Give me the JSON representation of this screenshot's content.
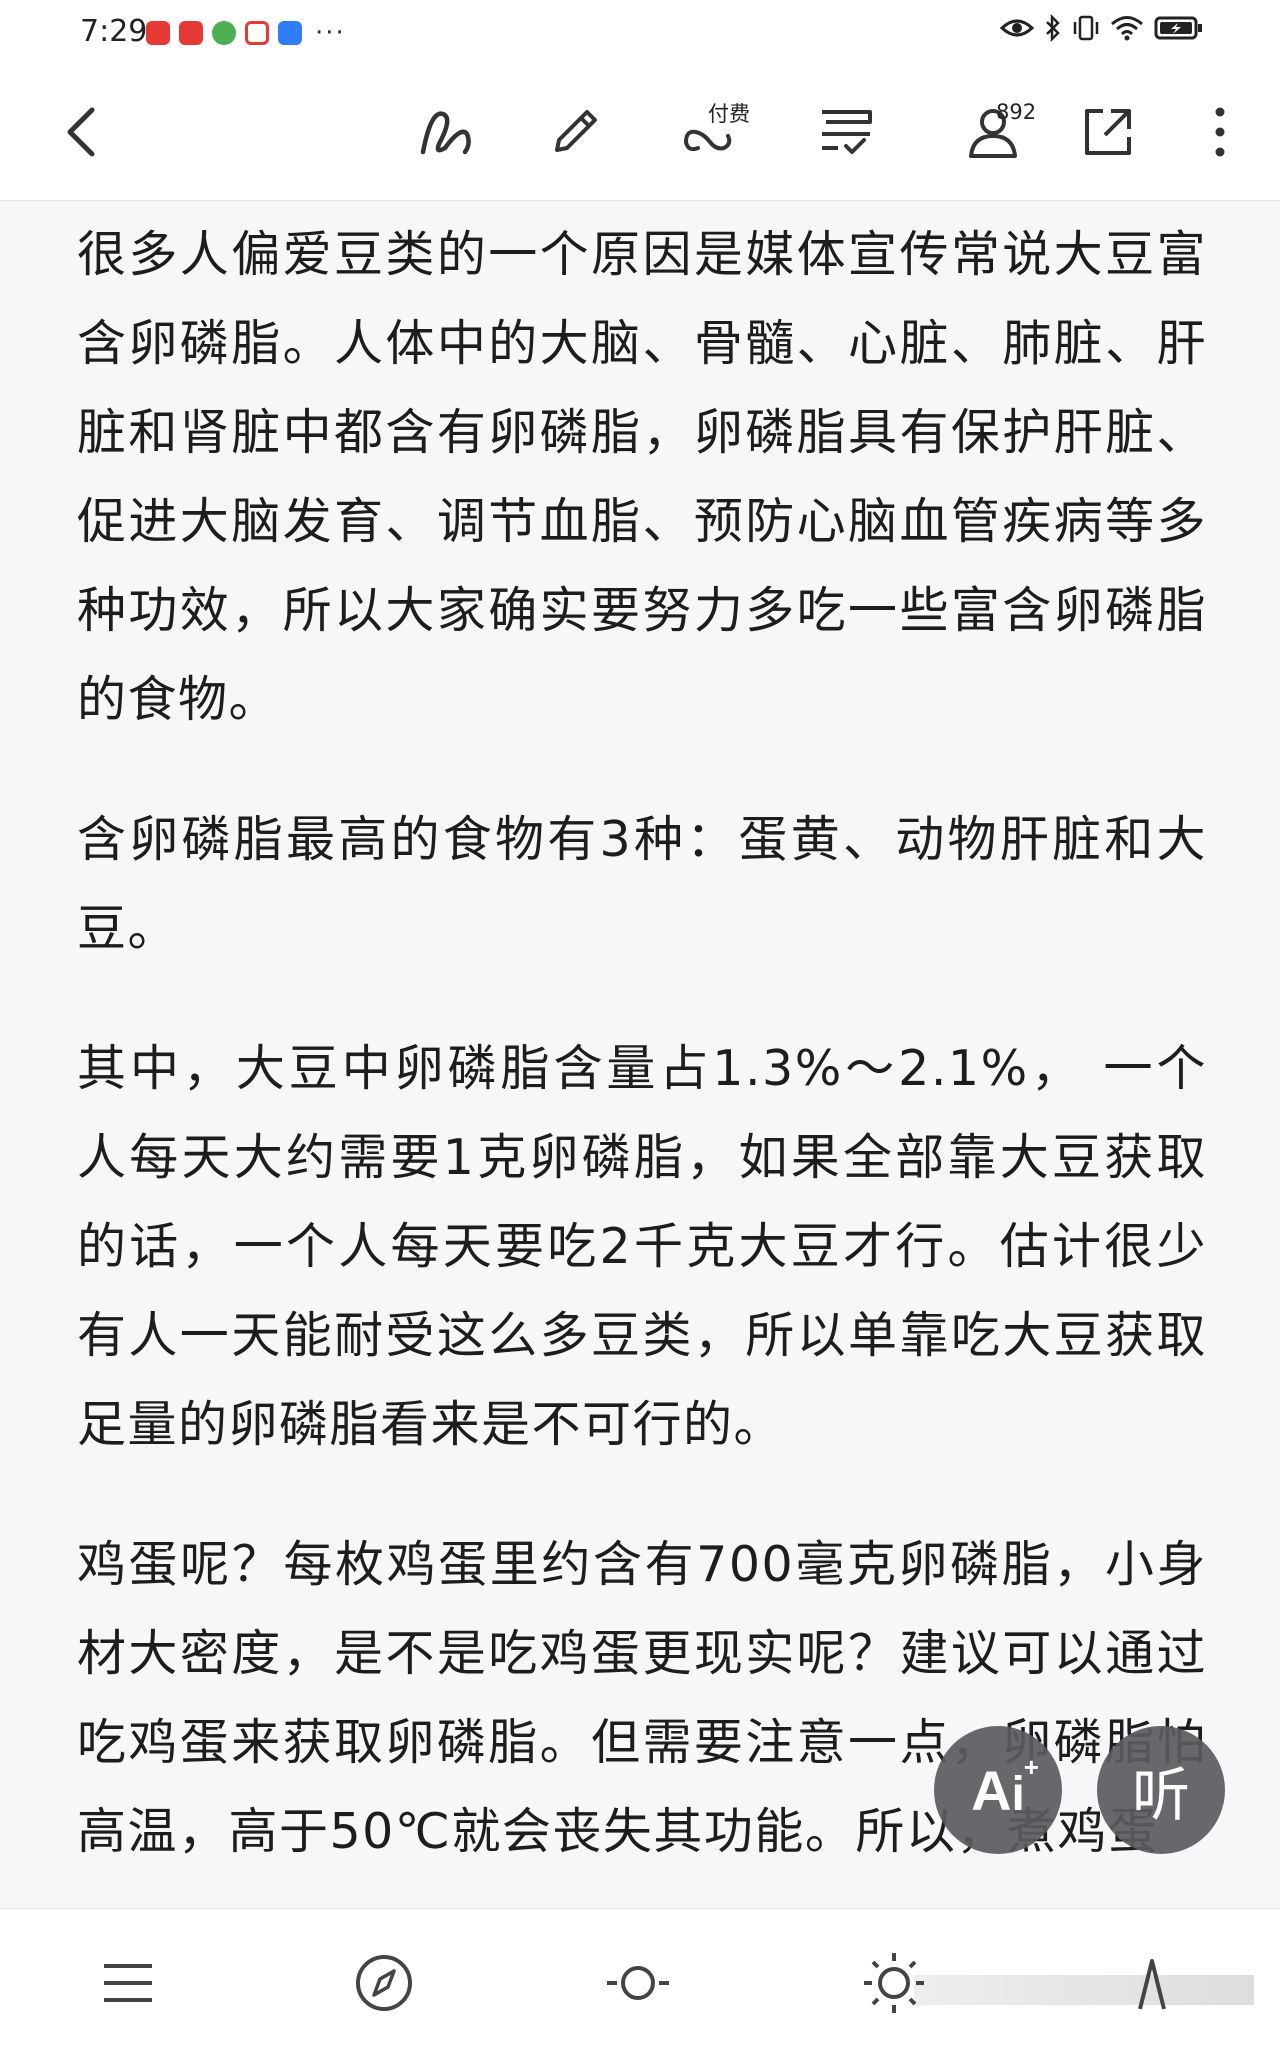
{
  "status_bar": {
    "time": "7:29",
    "more": "···",
    "colors": {
      "red": "#e53935",
      "green": "#4caf50",
      "blue": "#2f7df6"
    }
  },
  "toolbar": {
    "back_icon": "chevron-left-icon",
    "paid_label": "付费",
    "follower_count": "892"
  },
  "article": {
    "paragraphs": [
      "很多人偏爱豆类的一个原因是媒体宣传常说大豆富含卵磷脂。人体中的大脑、骨髓、心脏、肺脏、肝脏和肾脏中都含有卵磷脂，卵磷脂具有保护肝脏、促进大脑发育、调节血脂、预防心脑血管疾病等多种功效，所以大家确实要努力多吃一些富含卵磷脂的食物。",
      "含卵磷脂最高的食物有3种：蛋黄、动物肝脏和大豆。",
      "其中，大豆中卵磷脂含量占1.3%～2.1%， 一个人每天大约需要1克卵磷脂，如果全部靠大豆获取的话，一个人每天要吃2千克大豆才行。估计很少有人一天能耐受这么多豆类，所以单靠吃大豆获取足量的卵磷脂看来是不可行的。",
      "鸡蛋呢？每枚鸡蛋里约含有700毫克卵磷脂，小身材大密度，是不是吃鸡蛋更现实呢？建议可以通过吃鸡蛋来获取卵磷脂。但需要注意一点，卵磷脂怕高温，高于50℃就会丧失其功能。所以，煮鸡蛋"
    ]
  },
  "fab": {
    "ai_label": "A",
    "ai_sup": "+",
    "listen_label": "听"
  },
  "bottom_bar": {
    "icons": [
      "menu-icon",
      "compass-icon",
      "font-size-icon",
      "brightness-icon",
      "text-direction-icon"
    ]
  }
}
